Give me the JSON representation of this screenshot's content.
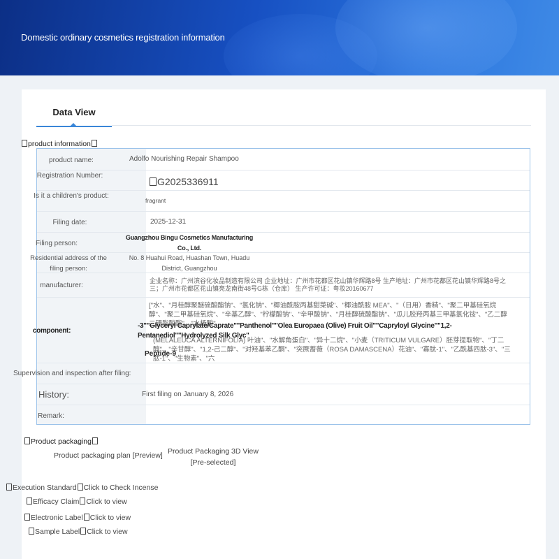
{
  "header": {
    "title": "Domestic ordinary cosmetics registration information"
  },
  "tabs": [
    {
      "label": "Data View"
    }
  ],
  "product_section": {
    "title": "product information"
  },
  "fields": {
    "product_name": {
      "label": "product name:",
      "value": "Adolfo Nourishing Repair Shampoo"
    },
    "registration_number": {
      "label": "Registration Number:",
      "value": "G2025336911",
      "prefix_glyphs": "5"
    },
    "children_product": {
      "label": "Is it a children's product:",
      "value": "fragrant"
    },
    "filing_date": {
      "label": "Filing date:",
      "value": "2025-12-31"
    },
    "filing_person": {
      "label": "Filing person:",
      "value": "Guangzhou Bingu Cosmetics Manufacturing Co., Ltd."
    },
    "residential_address": {
      "label": "Residential address of the filing person:",
      "value": "No. 8 Huahui Road, Huashan Town, Huadu District, Guangzhou"
    },
    "manufacturer": {
      "label": "manufacturer:",
      "value": "企业名称：广州滨谷化妆品制造有限公司 企业地址：广州市花都区花山镇华辉路8号 生产地址：广州市花都区花山镇华辉路8号之三；广州市花都区花山镇亮龙南街48号G栋（仓库） 生产许可证：粤妆20160677"
    },
    "component": {
      "label": "component:",
      "value_cn_top": "[\"水\"、\"月桂醇聚醚硫酸酯钠\"、\"氯化钠\"、\"椰油酰胺丙基甜菜碱\"、\"椰油酰胺 MEA\"、\"（日用）香精\"、\"聚二甲基硅氧烷醇\"、\"聚二甲基硅氧烷\"、\"辛基乙醇\"、\"柠檬酸钠\"、\"辛甲酸钠\"、\"月桂醇硫酸酯钠\"、\"瓜儿胶羟丙基三甲基氯化铵\"、\"乙二醇二硬脂酸酯\"、\"水杨酸\"",
      "value_en": "-3\"\"Glyceryl Caprylate/Caprate\"\"Panthenol\"\"Olea Europaea (Olive) Fruit Oil\"\"Capryloyl Glycine\"\"1,2-Pentanediol\"\"Hydrolyzed Silk Glyc\"",
      "value_cn_bottom": "(MELALEUCA ALTERNIFOLIA) 叶油\"、\"水解角蛋白\"、\"异十二烷\"、\"小麦（TRITICUM VULGARE）胚芽提取物\"、\"丁二醇\"、\"辛甘醇\"、\"1,2-己二醇\"、\"对羟基苯乙酮\"、\"突厥蔷薇（ROSA DAMASCENA）花油\"、\"寡肽-1\"、\"乙酰基四肽-3\"、\"三肽-1\"、\"生物素\"、\"六",
      "value_end": "Peptide-9"
    },
    "supervision": {
      "label": "Supervision and inspection after filing:",
      "value": ""
    },
    "history": {
      "label": "History:",
      "value": "First filing on January 8, 2026"
    },
    "remark": {
      "label": "Remark:",
      "value": ""
    }
  },
  "packaging": {
    "title": "Product packaging",
    "plan_link": "Product packaging plan [Preview]",
    "view3d_line1": "Product Packaging 3D View",
    "view3d_line2": "[Pre-selected]"
  },
  "links": [
    {
      "label": "Execution Standard",
      "action": "Click to Check Incense"
    },
    {
      "label": "Efficacy Claim",
      "action": "Click to view"
    },
    {
      "label": "Electronic Label",
      "action": "Click to view"
    },
    {
      "label": "Sample Label",
      "action": "Click to view"
    }
  ],
  "colors": {
    "banner": "#1750c2",
    "accent": "#3a86d8",
    "table_border": "#9cc3ea"
  }
}
